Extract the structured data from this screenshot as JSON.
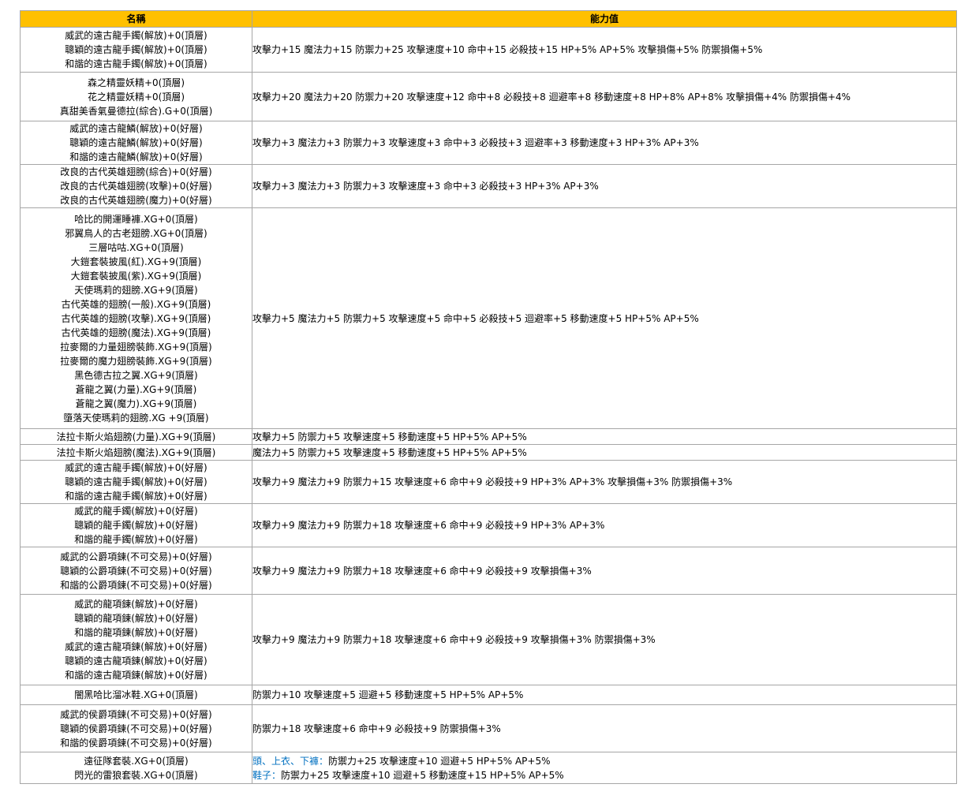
{
  "header": {
    "name": "名稱",
    "stats": "能力值"
  },
  "colors": {
    "header_bg": "#ffc000",
    "grid": "#a6a6a6",
    "highlight": "#0070c0"
  },
  "rows": [
    {
      "names": [
        "威武的遠古龍手鐲(解放)+0(頂層)",
        "聰穎的遠古龍手鐲(解放)+0(頂層)",
        "和諧的遠古龍手鐲(解放)+0(頂層)"
      ],
      "stats": "攻擊力+15 魔法力+15 防禦力+25 攻擊速度+10 命中+15 必殺技+15 HP+5% AP+5% 攻擊損傷+5% 防禦損傷+5%"
    },
    {
      "names": [
        "森之精靈妖精+0(頂層)",
        "花之精靈妖精+0(頂層)",
        "真甜美香氣曼德拉(綜合).G+0(頂層)"
      ],
      "stats": "攻擊力+20 魔法力+20 防禦力+20 攻擊速度+12 命中+8 必殺技+8 迴避率+8 移動速度+8 HP+8% AP+8% 攻擊損傷+4% 防禦損傷+4%"
    },
    {
      "names": [
        "威武的遠古龍鱗(解放)+0(好層)",
        "聰穎的遠古龍鱗(解放)+0(好層)",
        "和諧的遠古龍鱗(解放)+0(好層)"
      ],
      "stats": "攻擊力+3 魔法力+3 防禦力+3 攻擊速度+3 命中+3 必殺技+3 迴避率+3 移動速度+3  HP+3% AP+3%"
    },
    {
      "names": [
        "改良的古代英雄翅膀(綜合)+0(好層)",
        "改良的古代英雄翅膀(攻擊)+0(好層)",
        "改良的古代英雄翅膀(魔力)+0(好層)"
      ],
      "stats": "攻擊力+3 魔法力+3 防禦力+3 攻擊速度+3 命中+3 必殺技+3 HP+3% AP+3%"
    },
    {
      "names": [
        "哈比的開運睡褲.XG+0(頂層)",
        "邪翼鳥人的古老翅膀.XG+0(頂層)",
        "三層咕咕.XG+0(頂層)",
        "大鎧套裝披風(紅).XG+9(頂層)",
        "大鎧套裝披風(紫).XG+9(頂層)",
        "天使瑪莉的翅膀.XG+9(頂層)",
        "古代英雄的翅膀(一般).XG+9(頂層)",
        "古代英雄的翅膀(攻擊).XG+9(頂層)",
        "古代英雄的翅膀(魔法).XG+9(頂層)",
        "拉麥爾的力量翅膀裝飾.XG+9(頂層)",
        "拉麥爾的魔力翅膀裝飾.XG+9(頂層)",
        "黑色德古拉之翼.XG+9(頂層)",
        "蒼龍之翼(力量).XG+9(頂層)",
        "蒼龍之翼(魔力).XG+9(頂層)",
        "墮落天使瑪莉的翅膀.XG +9(頂層)"
      ],
      "stats": "攻擊力+5 魔法力+5 防禦力+5 攻擊速度+5 命中+5 必殺技+5 迴避率+5 移動速度+5  HP+5% AP+5%"
    },
    {
      "names": [
        "法拉卡斯火焰翅膀(力量).XG+9(頂層)"
      ],
      "stats": "攻擊力+5 防禦力+5 攻擊速度+5 移動速度+5 HP+5% AP+5%"
    },
    {
      "names": [
        "法拉卡斯火焰翅膀(魔法).XG+9(頂層)"
      ],
      "stats": "魔法力+5 防禦力+5 攻擊速度+5 移動速度+5 HP+5% AP+5%"
    },
    {
      "names": [
        "威武的遠古龍手鐲(解放)+0(好層)",
        "聰穎的遠古龍手鐲(解放)+0(好層)",
        "和諧的遠古龍手鐲(解放)+0(好層)"
      ],
      "stats": "攻擊力+9 魔法力+9 防禦力+15 攻擊速度+6 命中+9 必殺技+9  HP+3% AP+3% 攻擊損傷+3% 防禦損傷+3%"
    },
    {
      "names": [
        "威武的龍手鐲(解放)+0(好層)",
        "聰穎的龍手鐲(解放)+0(好層)",
        "和諧的龍手鐲(解放)+0(好層)"
      ],
      "stats": "攻擊力+9 魔法力+9 防禦力+18 攻擊速度+6 命中+9 必殺技+9  HP+3% AP+3%"
    },
    {
      "names": [
        "威武的公爵項鍊(不可交易)+0(好層)",
        "聰穎的公爵項鍊(不可交易)+0(好層)",
        "和諧的公爵項鍊(不可交易)+0(好層)"
      ],
      "stats": "攻擊力+9 魔法力+9 防禦力+18 攻擊速度+6 命中+9 必殺技+9 攻擊損傷+3%"
    },
    {
      "names": [
        "威武的龍項鍊(解放)+0(好層)",
        "聰穎的龍項鍊(解放)+0(好層)",
        "和諧的龍項鍊(解放)+0(好層)",
        "威武的遠古龍項鍊(解放)+0(好層)",
        "聰穎的遠古龍項鍊(解放)+0(好層)",
        "和諧的遠古龍項鍊(解放)+0(好層)"
      ],
      "stats": "攻擊力+9 魔法力+9 防禦力+18 攻擊速度+6 命中+9 必殺技+9 攻擊損傷+3% 防禦損傷+3%"
    },
    {
      "names": [
        "闇黑哈比溜冰鞋.XG+0(頂層)"
      ],
      "stats": "防禦力+10 攻擊速度+5 迴避+5 移動速度+5 HP+5% AP+5%"
    },
    {
      "names": [
        "威武的侯爵項鍊(不可交易)+0(好層)",
        "聰穎的侯爵項鍊(不可交易)+0(好層)",
        "和諧的侯爵項鍊(不可交易)+0(好層)"
      ],
      "stats": "防禦力+18 攻擊速度+6 命中+9 必殺技+9  防禦損傷+3%"
    },
    {
      "names": [
        "遠征隊套裝.XG+0(頂層)",
        "閃光的雷狼套裝.XG+0(頂層)"
      ],
      "stat_lines": [
        {
          "prefix": "頭、上衣、下褲：",
          "text": "防禦力+25 攻擊速度+10 迴避+5 HP+5% AP+5%"
        },
        {
          "prefix": "鞋子：",
          "text": "防禦力+25 攻擊速度+10 迴避+5 移動速度+15 HP+5% AP+5%"
        }
      ]
    }
  ]
}
